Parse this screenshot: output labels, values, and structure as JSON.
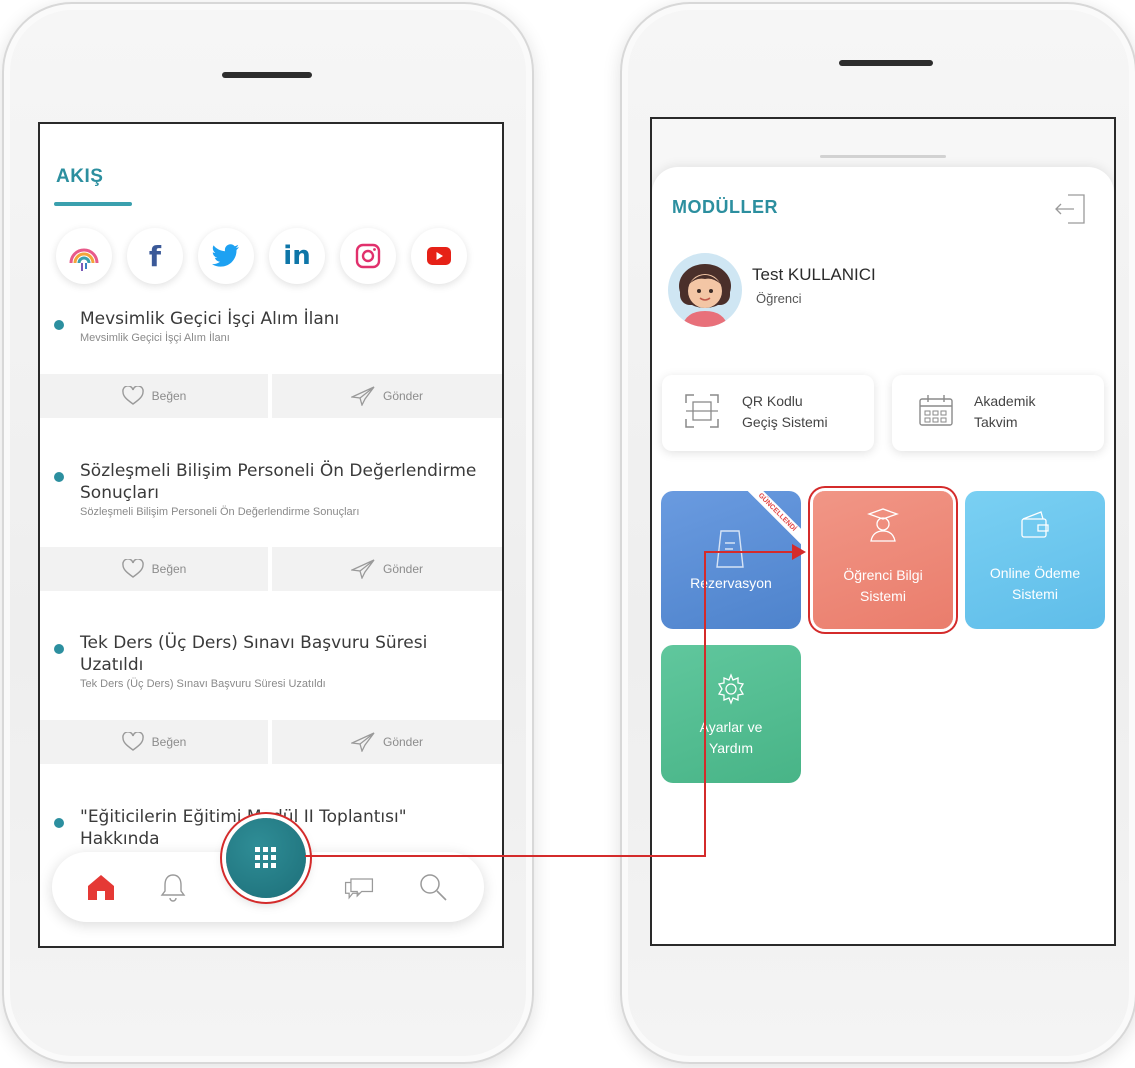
{
  "left_screen": {
    "feed_title": "AKIŞ",
    "social_icons": [
      "community-icon",
      "facebook-icon",
      "twitter-icon",
      "linkedin-icon",
      "instagram-icon",
      "youtube-icon"
    ],
    "posts": [
      {
        "title": "Mevsimlik Geçici İşçi Alım İlanı",
        "subtitle": "Mevsimlik Geçici İşçi Alım İlanı"
      },
      {
        "title": "Sözleşmeli Bilişim Personeli Ön Değerlendirme Sonuçları",
        "subtitle": "Sözleşmeli Bilişim Personeli Ön Değerlendirme Sonuçları"
      },
      {
        "title": "Tek Ders (Üç Ders) Sınavı Başvuru Süresi Uzatıldı",
        "subtitle": "Tek Ders (Üç Ders) Sınavı Başvuru Süresi Uzatıldı"
      },
      {
        "title": "\"Eğiticilerin Eğitimi Modül II Toplantısı\" Hakkında",
        "subtitle": ""
      }
    ],
    "actions": {
      "like": "Beğen",
      "send": "Gönder"
    },
    "bottom_nav": [
      "home-icon",
      "bell-icon",
      "modules-grid-icon",
      "chat-icon",
      "search-icon"
    ]
  },
  "right_screen": {
    "title": "MODÜLLER",
    "user": {
      "name": "Test KULLANICI",
      "role": "Öğrenci"
    },
    "quick_links": [
      {
        "line1": "QR Kodlu",
        "line2": "Geçiş Sistemi",
        "icon": "qr-scan-icon"
      },
      {
        "line1": "Akademik",
        "line2": "Takvim",
        "icon": "calendar-icon"
      }
    ],
    "tiles": [
      {
        "label_line1": "Rezervasyon",
        "label_line2": "",
        "icon": "reservation-icon",
        "badge": "GÜNCELLENDİ",
        "color": "#5b8fd6"
      },
      {
        "label_line1": "Öğrenci Bilgi",
        "label_line2": "Sistemi",
        "icon": "graduate-icon",
        "color": "#ef8a7a"
      },
      {
        "label_line1": "Online Ödeme",
        "label_line2": "Sistemi",
        "icon": "wallet-icon",
        "color": "#6cc7ee"
      },
      {
        "label_line1": "Ayarlar ve",
        "label_line2": "Yardım",
        "icon": "settings-icon",
        "color": "#55be92"
      }
    ]
  },
  "colors": {
    "accent": "#2c8f9f",
    "highlight": "#d42b2b",
    "home_active": "#e53935"
  }
}
